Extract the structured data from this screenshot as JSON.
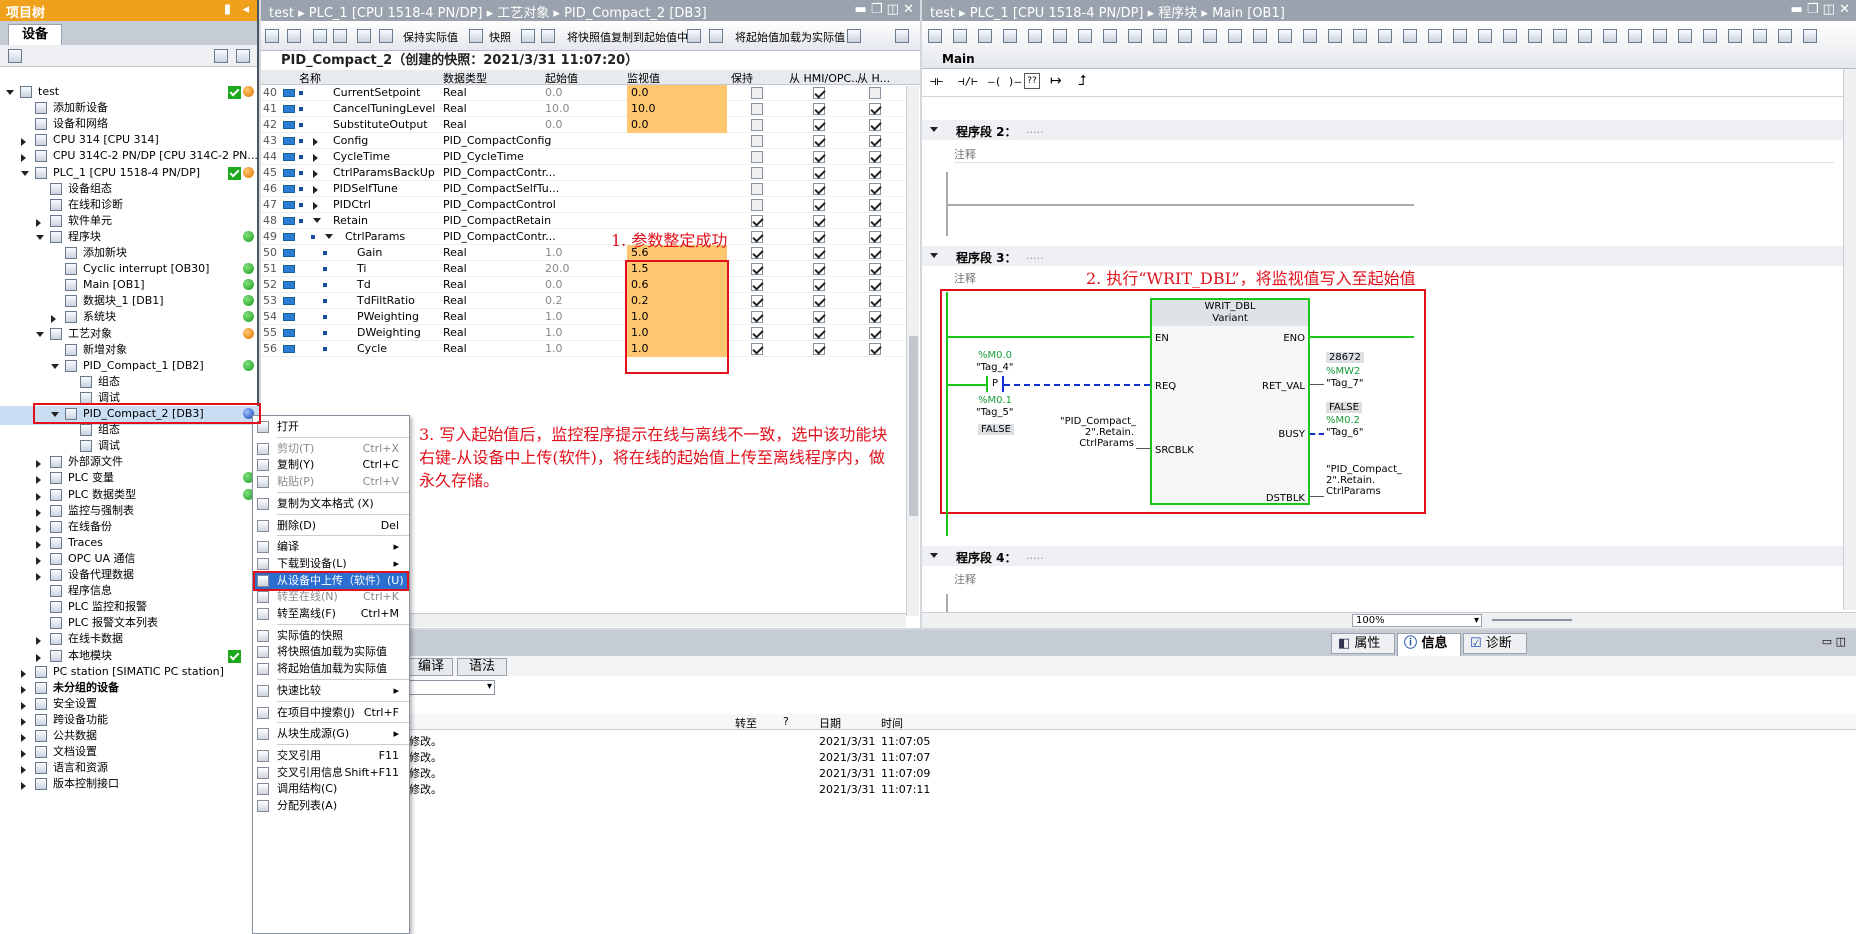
{
  "project_tree": {
    "title": "项目树",
    "tab": "设备",
    "items": [
      {
        "label": "test",
        "indent": 0,
        "exp": "down",
        "status": "chk-orange"
      },
      {
        "label": "添加新设备",
        "indent": 1,
        "exp": "none",
        "status": ""
      },
      {
        "label": "设备和网络",
        "indent": 1,
        "exp": "none",
        "status": ""
      },
      {
        "label": "CPU 314 [CPU 314]",
        "indent": 1,
        "exp": "right",
        "status": ""
      },
      {
        "label": "CPU 314C-2 PN/DP [CPU 314C-2 PN...",
        "indent": 1,
        "exp": "right",
        "status": ""
      },
      {
        "label": "PLC_1 [CPU 1518-4 PN/DP]",
        "indent": 1,
        "exp": "down",
        "status": "chk-orange"
      },
      {
        "label": "设备组态",
        "indent": 2,
        "exp": "none",
        "status": ""
      },
      {
        "label": "在线和诊断",
        "indent": 2,
        "exp": "none",
        "status": ""
      },
      {
        "label": "软件单元",
        "indent": 2,
        "exp": "right",
        "status": ""
      },
      {
        "label": "程序块",
        "indent": 2,
        "exp": "down",
        "status": "green"
      },
      {
        "label": "添加新块",
        "indent": 3,
        "exp": "none",
        "status": ""
      },
      {
        "label": "Cyclic interrupt [OB30]",
        "indent": 3,
        "exp": "none",
        "status": "green"
      },
      {
        "label": "Main [OB1]",
        "indent": 3,
        "exp": "none",
        "status": "green"
      },
      {
        "label": "数据块_1 [DB1]",
        "indent": 3,
        "exp": "none",
        "status": "green"
      },
      {
        "label": "系统块",
        "indent": 3,
        "exp": "right",
        "status": "green"
      },
      {
        "label": "工艺对象",
        "indent": 2,
        "exp": "down",
        "status": "orange"
      },
      {
        "label": "新增对象",
        "indent": 3,
        "exp": "none",
        "status": ""
      },
      {
        "label": "PID_Compact_1 [DB2]",
        "indent": 3,
        "exp": "down",
        "status": "green"
      },
      {
        "label": "组态",
        "indent": 4,
        "exp": "none",
        "status": ""
      },
      {
        "label": "调试",
        "indent": 4,
        "exp": "none",
        "status": ""
      },
      {
        "label": "PID_Compact_2 [DB3]",
        "indent": 3,
        "exp": "down",
        "status": "",
        "selected": true
      },
      {
        "label": "组态",
        "indent": 4,
        "exp": "none",
        "status": ""
      },
      {
        "label": "调试",
        "indent": 4,
        "exp": "none",
        "status": ""
      },
      {
        "label": "外部源文件",
        "indent": 2,
        "exp": "right",
        "status": ""
      },
      {
        "label": "PLC 变量",
        "indent": 2,
        "exp": "right",
        "status": "green"
      },
      {
        "label": "PLC 数据类型",
        "indent": 2,
        "exp": "right",
        "status": "green"
      },
      {
        "label": "监控与强制表",
        "indent": 2,
        "exp": "right",
        "status": ""
      },
      {
        "label": "在线备份",
        "indent": 2,
        "exp": "right",
        "status": ""
      },
      {
        "label": "Traces",
        "indent": 2,
        "exp": "right",
        "status": ""
      },
      {
        "label": "OPC UA 通信",
        "indent": 2,
        "exp": "right",
        "status": ""
      },
      {
        "label": "设备代理数据",
        "indent": 2,
        "exp": "right",
        "status": ""
      },
      {
        "label": "程序信息",
        "indent": 2,
        "exp": "none",
        "status": ""
      },
      {
        "label": "PLC 监控和报警",
        "indent": 2,
        "exp": "none",
        "status": ""
      },
      {
        "label": "PLC 报警文本列表",
        "indent": 2,
        "exp": "none",
        "status": ""
      },
      {
        "label": "在线卡数据",
        "indent": 2,
        "exp": "right",
        "status": ""
      },
      {
        "label": "本地模块",
        "indent": 2,
        "exp": "right",
        "status": "chk"
      },
      {
        "label": "PC station [SIMATIC PC station]",
        "indent": 1,
        "exp": "right",
        "status": ""
      },
      {
        "label": "未分组的设备",
        "indent": 1,
        "exp": "right",
        "status": "",
        "bold": true
      },
      {
        "label": "安全设置",
        "indent": 1,
        "exp": "right",
        "status": ""
      },
      {
        "label": "跨设备功能",
        "indent": 1,
        "exp": "right",
        "status": ""
      },
      {
        "label": "公共数据",
        "indent": 1,
        "exp": "right",
        "status": ""
      },
      {
        "label": "文档设置",
        "indent": 1,
        "exp": "right",
        "status": ""
      },
      {
        "label": "语言和资源",
        "indent": 1,
        "exp": "right",
        "status": ""
      },
      {
        "label": "版本控制接口",
        "indent": 1,
        "exp": "right",
        "status": ""
      }
    ]
  },
  "mid": {
    "breadcrumb": "test ▸ PLC_1 [CPU 1518-4 PN/DP] ▸ 工艺对象 ▸ PID_Compact_2 [DB3]",
    "tb1": "保持实际值",
    "tb2": "快照",
    "tb3": "将快照值复制到起始值中",
    "tb4": "将起始值加载为实际值",
    "snapshot": "PID_Compact_2（创建的快照：2021/3/31 11:07:20）",
    "cols": [
      "名称",
      "数据类型",
      "起始值",
      "监视值",
      "保持",
      "从 HMI/OPC..",
      "从 H..."
    ],
    "rows": [
      {
        "n": "40",
        "name": "CurrentSetpoint",
        "ind": 1,
        "exp": "",
        "type": "Real",
        "start": "0.0",
        "mon": "0.0",
        "hl": true,
        "keep": false
      },
      {
        "n": "41",
        "name": "CancelTuningLevel",
        "ind": 1,
        "exp": "",
        "type": "Real",
        "start": "10.0",
        "mon": "10.0",
        "hl": true,
        "keep": false
      },
      {
        "n": "42",
        "name": "SubstituteOutput",
        "ind": 1,
        "exp": "",
        "type": "Real",
        "start": "0.0",
        "mon": "0.0",
        "hl": true,
        "keep": false
      },
      {
        "n": "43",
        "name": "Config",
        "ind": 1,
        "exp": "r",
        "type": "PID_CompactConfig",
        "start": "",
        "mon": "",
        "hl": false,
        "keep": false
      },
      {
        "n": "44",
        "name": "CycleTime",
        "ind": 1,
        "exp": "r",
        "type": "PID_CycleTime",
        "start": "",
        "mon": "",
        "hl": false,
        "keep": false
      },
      {
        "n": "45",
        "name": "CtrlParamsBackUp",
        "ind": 1,
        "exp": "r",
        "type": "PID_CompactContr...",
        "start": "",
        "mon": "",
        "hl": false,
        "keep": false
      },
      {
        "n": "46",
        "name": "PIDSelfTune",
        "ind": 1,
        "exp": "r",
        "type": "PID_CompactSelfTu...",
        "start": "",
        "mon": "",
        "hl": false,
        "keep": false
      },
      {
        "n": "47",
        "name": "PIDCtrl",
        "ind": 1,
        "exp": "r",
        "type": "PID_CompactControl",
        "start": "",
        "mon": "",
        "hl": false,
        "keep": false
      },
      {
        "n": "48",
        "name": "Retain",
        "ind": 1,
        "exp": "d",
        "type": "PID_CompactRetain",
        "start": "",
        "mon": "",
        "hl": false,
        "keep": true
      },
      {
        "n": "49",
        "name": "CtrlParams",
        "ind": 2,
        "exp": "d",
        "type": "PID_CompactContr...",
        "start": "",
        "mon": "",
        "hl": false,
        "keep": true
      },
      {
        "n": "50",
        "name": "Gain",
        "ind": 3,
        "exp": "",
        "type": "Real",
        "start": "1.0",
        "mon": "5.6",
        "hl": true,
        "keep": true
      },
      {
        "n": "51",
        "name": "Ti",
        "ind": 3,
        "exp": "",
        "type": "Real",
        "start": "20.0",
        "mon": "1.5",
        "hl": true,
        "keep": true
      },
      {
        "n": "52",
        "name": "Td",
        "ind": 3,
        "exp": "",
        "type": "Real",
        "start": "0.0",
        "mon": "0.6",
        "hl": true,
        "keep": true
      },
      {
        "n": "53",
        "name": "TdFiltRatio",
        "ind": 3,
        "exp": "",
        "type": "Real",
        "start": "0.2",
        "mon": "0.2",
        "hl": true,
        "keep": true
      },
      {
        "n": "54",
        "name": "PWeighting",
        "ind": 3,
        "exp": "",
        "type": "Real",
        "start": "1.0",
        "mon": "1.0",
        "hl": true,
        "keep": true
      },
      {
        "n": "55",
        "name": "DWeighting",
        "ind": 3,
        "exp": "",
        "type": "Real",
        "start": "1.0",
        "mon": "1.0",
        "hl": true,
        "keep": true
      },
      {
        "n": "56",
        "name": "Cycle",
        "ind": 3,
        "exp": "",
        "type": "Real",
        "start": "1.0",
        "mon": "1.0",
        "hl": true,
        "keep": true
      }
    ],
    "note1": "1. 参数整定成功",
    "note3": "3. 写入起始值后，监控程序提示在线与离线不一致，选中该功能块右键-从设备中上传(软件)，将在线的起始值上传至离线程序内，做永久存储。"
  },
  "right": {
    "breadcrumb": "test ▸ PLC_1 [CPU 1518-4 PN/DP] ▸ 程序块 ▸ Main [OB1]",
    "block": "Main",
    "nw2": "程序段 2：",
    "nw3": "程序段 3：",
    "nw4": "程序段 4：",
    "comment": "注释",
    "dots": ".....",
    "note2": "2. 执行“WRIT_DBL”，将监视值写入至起始值",
    "fb_title": "WRIT_DBL",
    "fb_sub": "Variant",
    "en": "EN",
    "eno": "ENO",
    "req": "REQ",
    "ret": "RET_VAL",
    "busy": "BUSY",
    "src": "SRCBLK",
    "dst": "DSTBLK",
    "m00": "%M0.0",
    "tag4": "\"Tag_4\"",
    "p": "P",
    "m01": "%M0.1",
    "tag5": "\"Tag_5\"",
    "false1": "FALSE",
    "srcv": "\"PID_Compact_ 2\".Retain. CtrlParams",
    "retv": "28672",
    "mw2": "%MW2",
    "tag7": "\"Tag_7\"",
    "false2": "FALSE",
    "m02": "%M0.2",
    "tag6": "\"Tag_6\"",
    "dstv": "\"PID_Compact_ 2\".Retain. CtrlParams",
    "zoom": "100%"
  },
  "bottom": {
    "tabs": [
      "属性",
      "信息",
      "诊断"
    ],
    "subtabs": [
      "编译",
      "语法"
    ],
    "cols": [
      "转至",
      "?",
      "日期",
      "时间"
    ],
    "rows": [
      {
        "msg": "修改。",
        "date": "2021/3/31",
        "time": "11:07:05"
      },
      {
        "msg": "修改。",
        "date": "2021/3/31",
        "time": "11:07:07"
      },
      {
        "msg": "修改。",
        "date": "2021/3/31",
        "time": "11:07:09"
      },
      {
        "msg": "修改。",
        "date": "2021/3/31",
        "time": "11:07:11"
      }
    ]
  },
  "menu": {
    "items": [
      {
        "l": "打开",
        "s": "",
        "dis": false,
        "sub": false
      },
      {
        "sep": true
      },
      {
        "l": "剪切(T)",
        "s": "Ctrl+X",
        "dis": true,
        "sub": false
      },
      {
        "l": "复制(Y)",
        "s": "Ctrl+C",
        "dis": false,
        "sub": false
      },
      {
        "l": "粘贴(P)",
        "s": "Ctrl+V",
        "dis": true,
        "sub": false
      },
      {
        "sep": true
      },
      {
        "l": "复制为文本格式 (X)",
        "s": "",
        "dis": false,
        "sub": false
      },
      {
        "sep": true
      },
      {
        "l": "删除(D)",
        "s": "Del",
        "dis": false,
        "sub": false
      },
      {
        "sep": true
      },
      {
        "l": "编译",
        "s": "",
        "dis": false,
        "sub": true
      },
      {
        "l": "下载到设备(L)",
        "s": "",
        "dis": false,
        "sub": true
      },
      {
        "l": "从设备中上传（软件）(U)",
        "s": "",
        "dis": false,
        "sub": false,
        "hl": true
      },
      {
        "l": "转至在线(N)",
        "s": "Ctrl+K",
        "dis": true,
        "sub": false
      },
      {
        "l": "转至离线(F)",
        "s": "Ctrl+M",
        "dis": false,
        "sub": false
      },
      {
        "sep": true
      },
      {
        "l": "实际值的快照",
        "s": "",
        "dis": false,
        "sub": false
      },
      {
        "l": "将快照值加载为实际值",
        "s": "",
        "dis": false,
        "sub": false
      },
      {
        "l": "将起始值加载为实际值",
        "s": "",
        "dis": false,
        "sub": false
      },
      {
        "sep": true
      },
      {
        "l": "快速比较",
        "s": "",
        "dis": false,
        "sub": true
      },
      {
        "sep": true
      },
      {
        "l": "在项目中搜索(J)",
        "s": "Ctrl+F",
        "dis": false,
        "sub": false
      },
      {
        "sep": true
      },
      {
        "l": "从块生成源(G)",
        "s": "",
        "dis": false,
        "sub": true
      },
      {
        "sep": true
      },
      {
        "l": "交叉引用",
        "s": "F11",
        "dis": false,
        "sub": false
      },
      {
        "l": "交叉引用信息",
        "s": "Shift+F11",
        "dis": false,
        "sub": false
      },
      {
        "l": "调用结构(C)",
        "s": "",
        "dis": false,
        "sub": false
      },
      {
        "l": "分配列表(A)",
        "s": "",
        "dis": false,
        "sub": false
      }
    ]
  }
}
